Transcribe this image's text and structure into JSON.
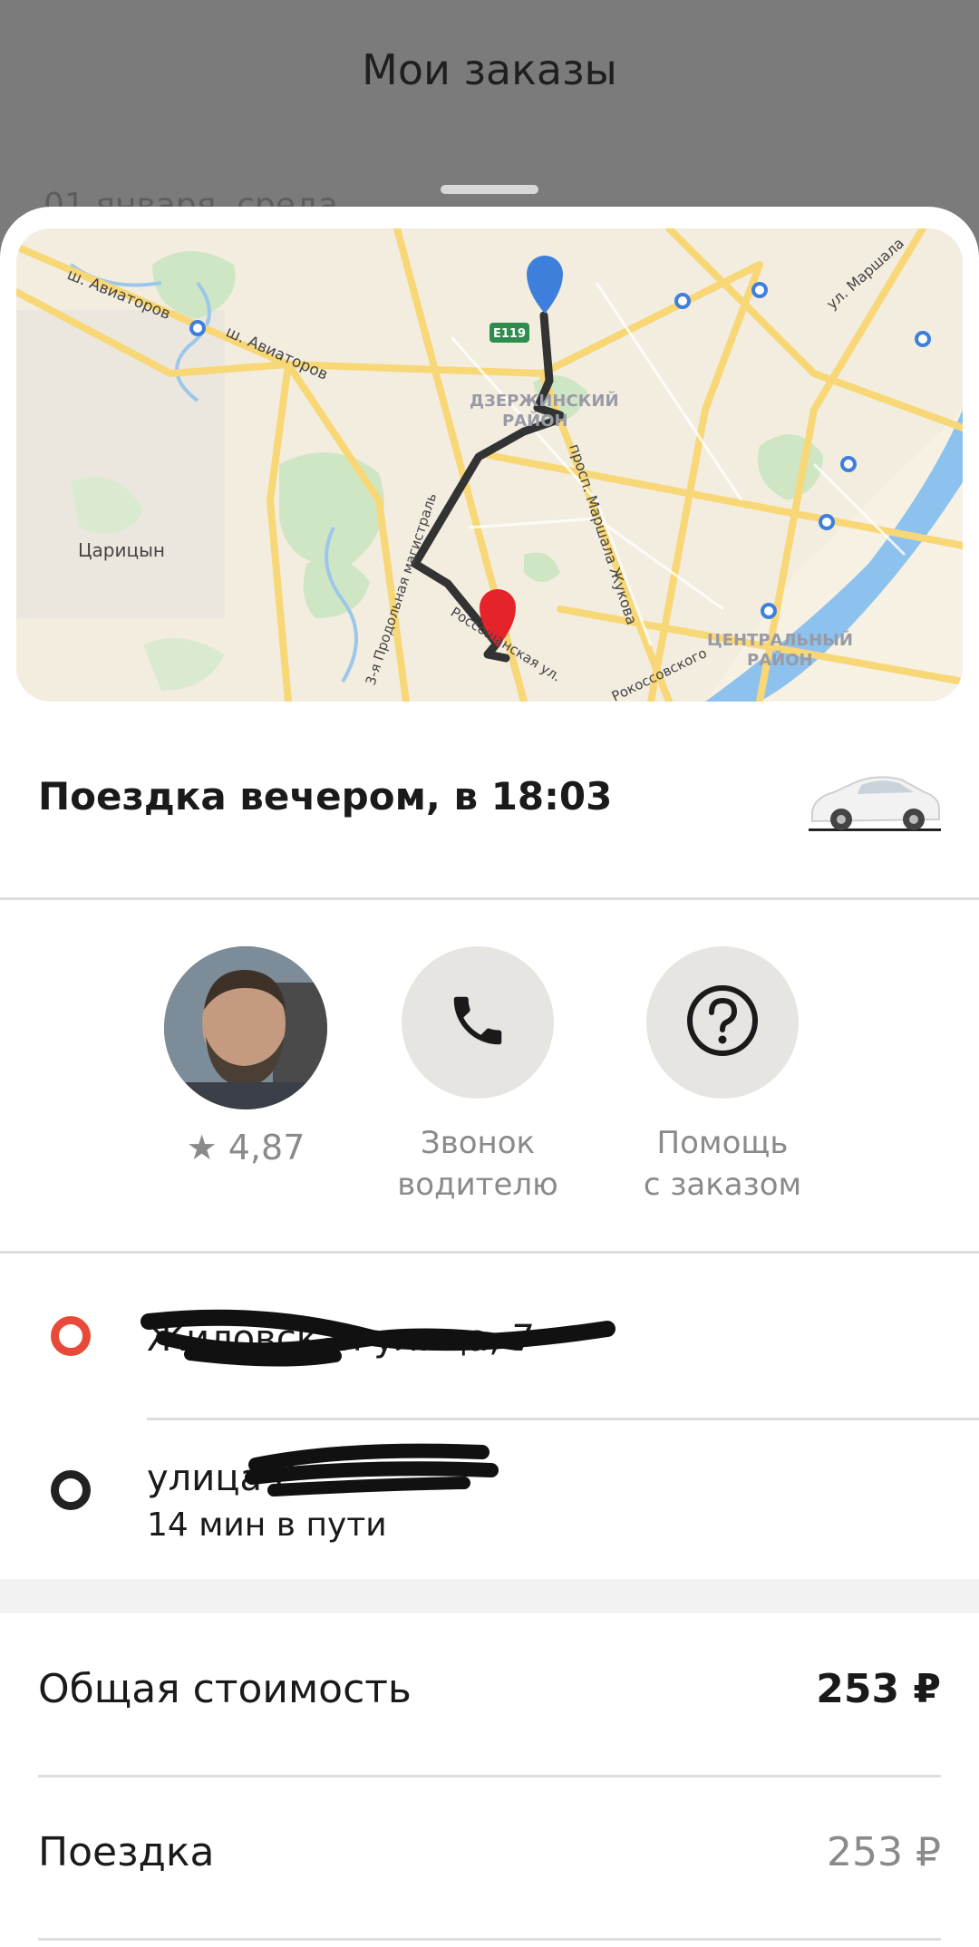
{
  "header": {
    "title": "Мои заказы",
    "date_partial": "01 января, среда"
  },
  "map": {
    "labels": {
      "road1": "ш. Авиаторов",
      "road2": "ш. Авиаторов",
      "district1": "ДЗЕРЖИНСКИЙ",
      "district1b": "РАЙОН",
      "road3": "просп. Маршала Жукова",
      "road4": "ул. Маршала",
      "city": "Царицын",
      "road5": "3-я Продольная магистраль",
      "district2": "ЦЕНТРАЛЬНЫЙ",
      "district2b": "РАЙОН",
      "road6": "Россошанская ул.",
      "road7": "Рокоссовского",
      "highway_badge": "E119"
    },
    "pin_start_color": "#3f7fdc",
    "pin_end_color": "#e4232a"
  },
  "trip": {
    "title": "Поездка вечером, в 18:03",
    "icon": "car-icon"
  },
  "actions": {
    "driver": {
      "rating": "★ 4,87",
      "icon": "avatar"
    },
    "call": {
      "label_line1": "Звонок",
      "label_line2": "водителю",
      "icon": "phone-icon"
    },
    "help": {
      "label_line1": "Помощь",
      "label_line2": "с заказом",
      "icon": "question-icon"
    }
  },
  "route": {
    "from": {
      "address": "Жиловская улица, 7",
      "dot_color": "#e84a3a"
    },
    "to": {
      "address": "улица Г",
      "duration": "14 мин в пути",
      "dot_color": "#222222"
    }
  },
  "pricing": {
    "total_label": "Общая стоимость",
    "total_value": "253 ₽",
    "ride_label": "Поездка",
    "ride_value": "253 ₽"
  }
}
